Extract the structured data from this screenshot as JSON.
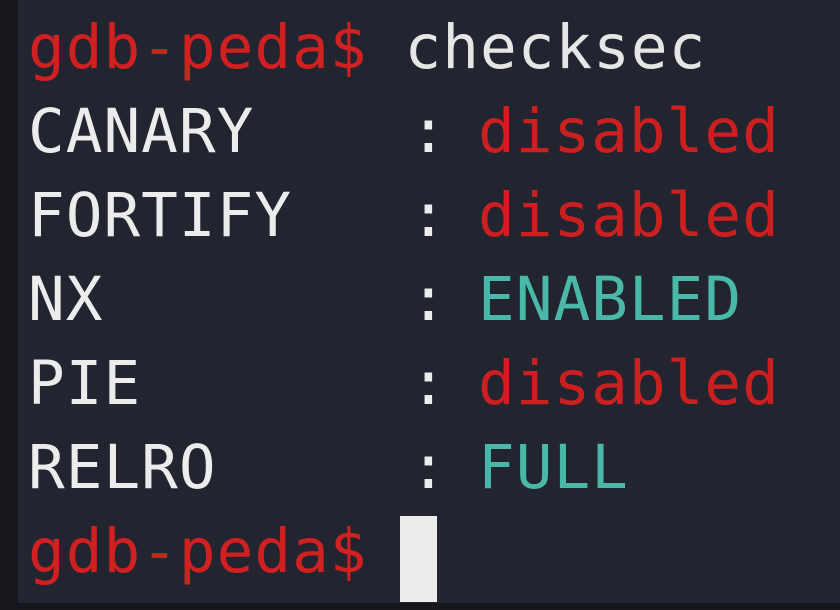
{
  "terminal": {
    "prompt": "gdb-peda$",
    "command": "checksec",
    "rows": [
      {
        "key": "CANARY",
        "sep": ":",
        "value": "disabled",
        "status_color": "#cc1f1f"
      },
      {
        "key": "FORTIFY",
        "sep": ":",
        "value": "disabled",
        "status_color": "#cc1f1f"
      },
      {
        "key": "NX",
        "sep": ":",
        "value": "ENABLED",
        "status_color": "#49b8a8"
      },
      {
        "key": "PIE",
        "sep": ":",
        "value": "disabled",
        "status_color": "#cc1f1f"
      },
      {
        "key": "RELRO",
        "sep": ":",
        "value": "FULL",
        "status_color": "#49b8a8"
      }
    ],
    "colors": {
      "background": "#222530",
      "prompt": "#d02020",
      "text": "#e8e8e8"
    }
  }
}
